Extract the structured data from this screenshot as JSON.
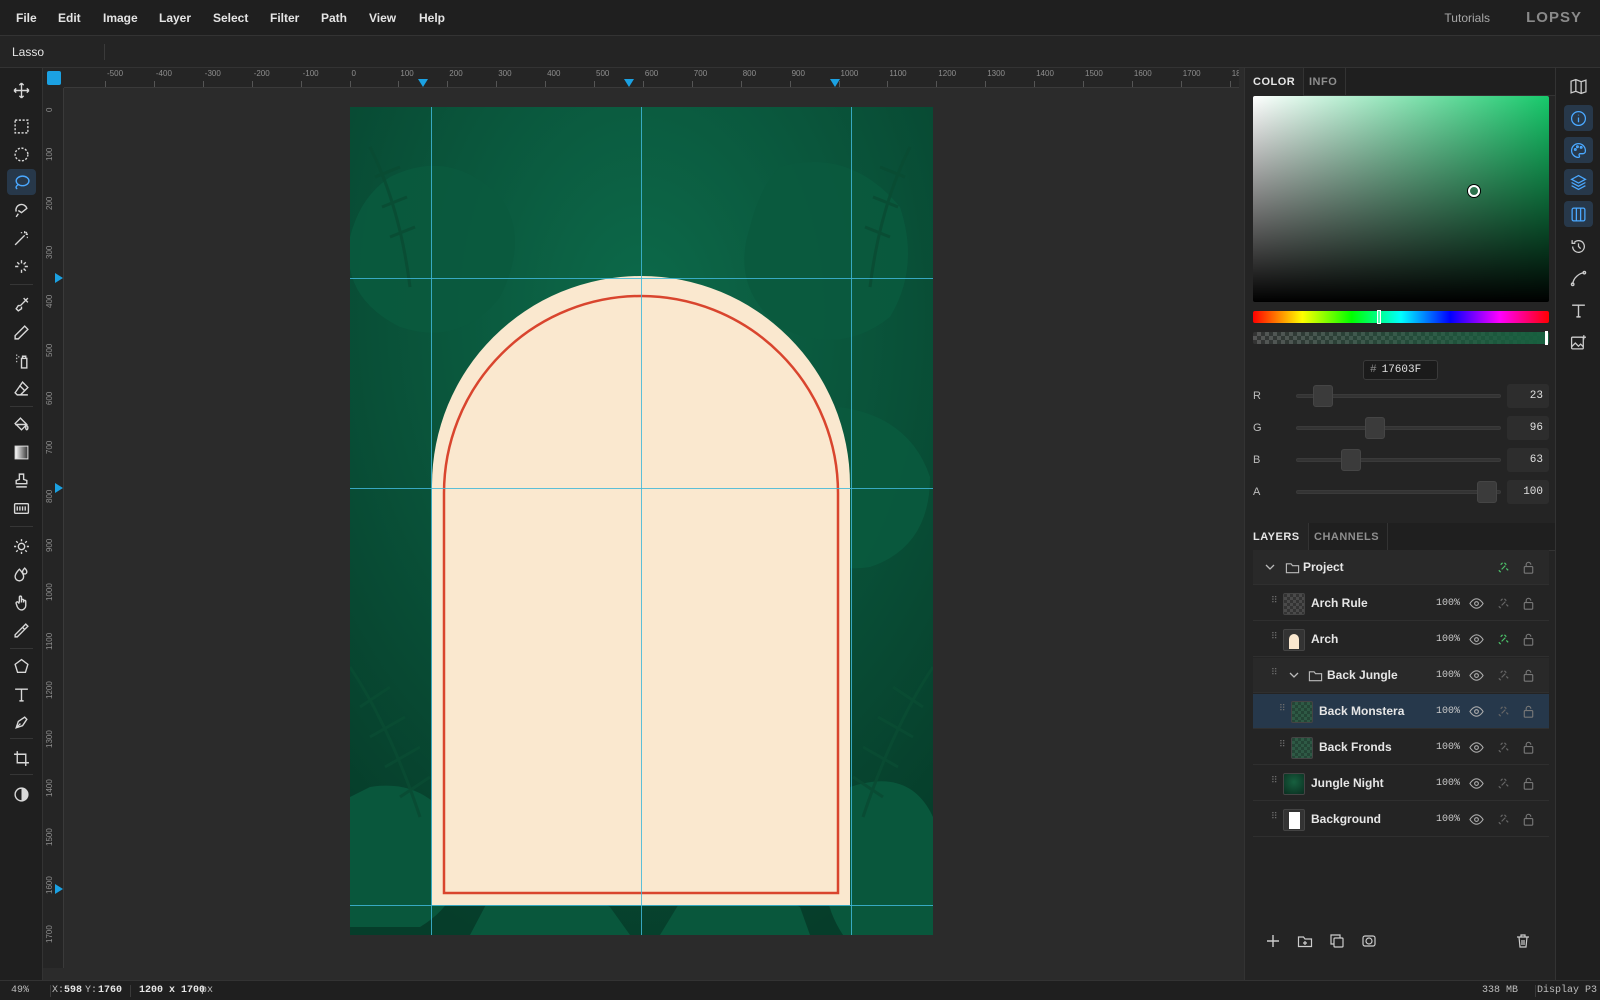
{
  "menubar": {
    "items": [
      "File",
      "Edit",
      "Image",
      "Layer",
      "Select",
      "Filter",
      "Path",
      "View",
      "Help"
    ],
    "tutorials": "Tutorials",
    "logo": "LOPSY"
  },
  "options_bar": {
    "tool_name": "Lasso"
  },
  "toolbar": {
    "active_tool": "lasso-tool",
    "tools": [
      "move",
      "rect-select",
      "ellipse-select",
      "lasso",
      "magnetic-lasso",
      "magic-wand",
      "quick-select",
      "brush",
      "pencil",
      "spray",
      "eraser",
      "fill-bucket",
      "gradient",
      "stamp",
      "pattern",
      "dodge",
      "blur",
      "smudge",
      "eyedropper",
      "shape",
      "type",
      "pen",
      "crop",
      "invert"
    ]
  },
  "rulers": {
    "h_labels": [
      "-500",
      "-400",
      "-300",
      "-200",
      "-100",
      "0",
      "100",
      "200",
      "300",
      "400",
      "500",
      "600",
      "700",
      "800",
      "900",
      "1000",
      "1100",
      "1200",
      "1300",
      "1400",
      "1500",
      "1600",
      "1700",
      "180"
    ],
    "v_labels": [
      "0",
      "100",
      "200",
      "300",
      "400",
      "500",
      "600",
      "700",
      "800",
      "900",
      "1000",
      "1100",
      "1200",
      "1300",
      "1400",
      "1500",
      "1600",
      "1700"
    ]
  },
  "canvas": {
    "background_color": "#0a4d36",
    "arch_color": "#fae8cf",
    "arch_rule_color": "#d9452e",
    "guide_color": "#3fb7d8"
  },
  "color_panel": {
    "tabs": [
      "COLOR",
      "INFO"
    ],
    "active_tab": "COLOR",
    "hex_prefix": "#",
    "hex": "17603F",
    "channels": [
      {
        "label": "R",
        "value": "23",
        "fraction": 0.09
      },
      {
        "label": "G",
        "value": "96",
        "fraction": 0.376
      },
      {
        "label": "B",
        "value": "63",
        "fraction": 0.247
      },
      {
        "label": "A",
        "value": "100",
        "fraction": 1.0
      }
    ]
  },
  "layers_panel": {
    "tabs": [
      "LAYERS",
      "CHANNELS"
    ],
    "active_tab": "LAYERS",
    "rows": [
      {
        "name": "Project",
        "opacity": "",
        "type": "group",
        "depth": 0,
        "selected": false,
        "linked": true
      },
      {
        "name": "Arch Rule",
        "opacity": "100%",
        "type": "layer",
        "depth": 0,
        "selected": false,
        "linked": false
      },
      {
        "name": "Arch",
        "opacity": "100%",
        "type": "layer",
        "depth": 0,
        "selected": false,
        "linked": true
      },
      {
        "name": "Back Jungle",
        "opacity": "100%",
        "type": "group",
        "depth": 1,
        "selected": false,
        "linked": false
      },
      {
        "name": "Back Monstera",
        "opacity": "100%",
        "type": "layer",
        "depth": 2,
        "selected": true,
        "linked": false
      },
      {
        "name": "Back Fronds",
        "opacity": "100%",
        "type": "layer",
        "depth": 2,
        "selected": false,
        "linked": false
      },
      {
        "name": "Jungle Night",
        "opacity": "100%",
        "type": "layer",
        "depth": 0,
        "selected": false,
        "linked": false
      },
      {
        "name": "Background",
        "opacity": "100%",
        "type": "layer",
        "depth": 0,
        "selected": false,
        "linked": false
      }
    ]
  },
  "status": {
    "zoom": "49%",
    "x_label": "X:",
    "x": "598",
    "y_label": "Y:",
    "y": "1760",
    "doc_size": "1200 x 1700",
    "doc_unit": "px",
    "memory": "338 MB",
    "color_profile": "Display P3"
  }
}
